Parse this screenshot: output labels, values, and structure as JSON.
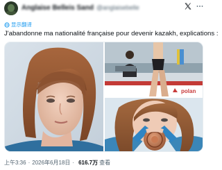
{
  "post": {
    "author_name": "Anglaise Belleis Sand",
    "author_handle": "@anglaisebelle",
    "text": "J'abandonne ma nationalité française pour devenir kazakh, explications :",
    "translate_label": "显示翻译",
    "time": "上午3:36",
    "date": "2026年6月18日",
    "separator": "·",
    "views": "616.7万",
    "views_label": "查看"
  },
  "media": {
    "banner_text": "polan"
  },
  "icons": {
    "brand": "x-logo-icon",
    "more": "more-icon",
    "globe": "globe-icon"
  },
  "colors": {
    "link": "#1d9bf0",
    "text": "#0f1419",
    "muted": "#536471"
  }
}
